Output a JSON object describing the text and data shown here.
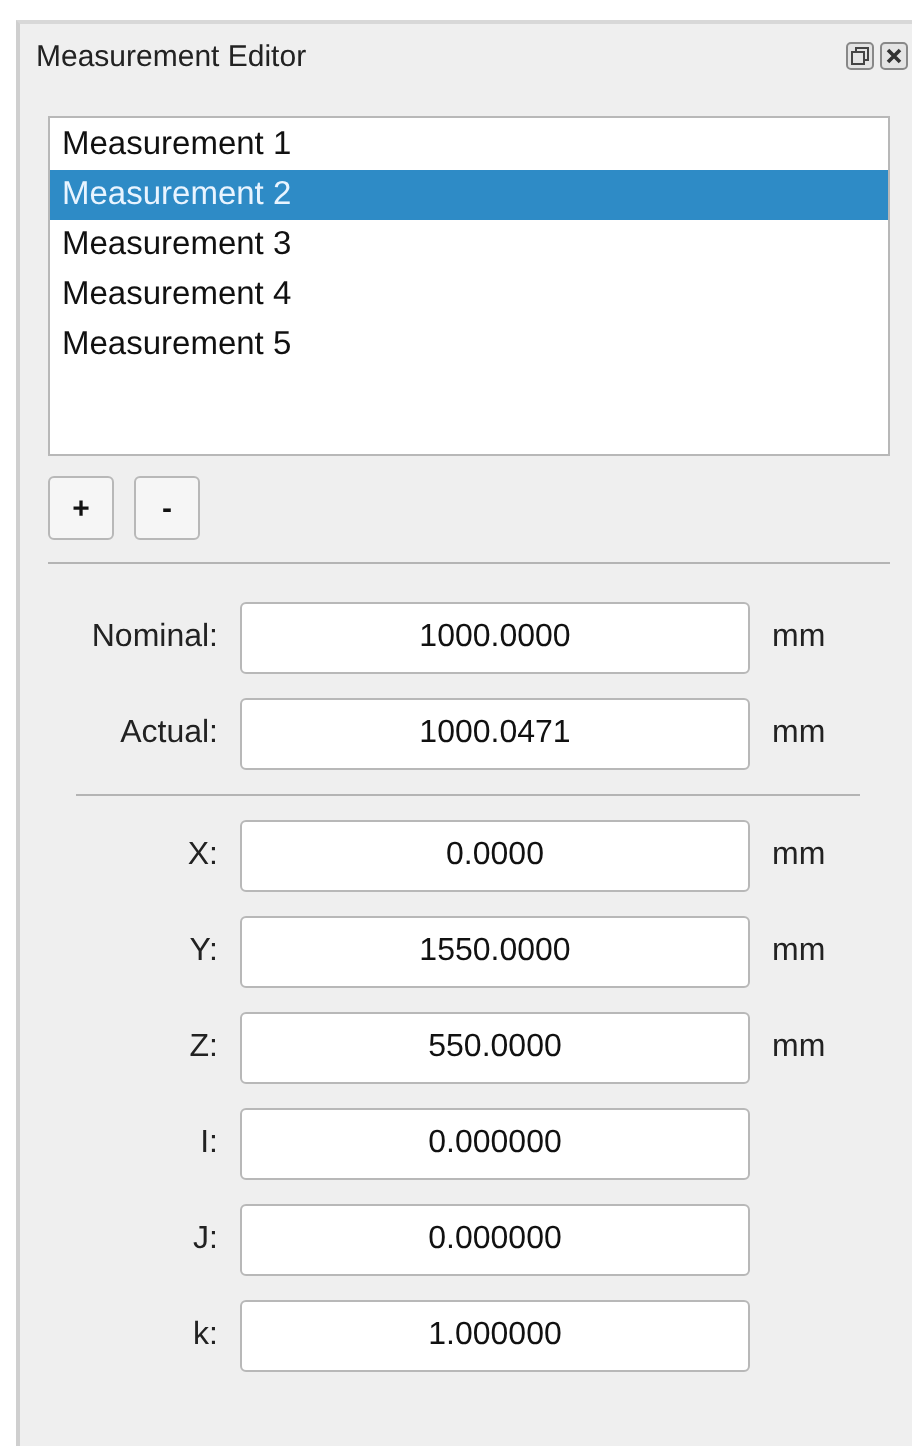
{
  "window": {
    "title": "Measurement Editor"
  },
  "measurements": [
    {
      "label": "Measurement 1",
      "selected": false
    },
    {
      "label": "Measurement 2",
      "selected": true
    },
    {
      "label": "Measurement 3",
      "selected": false
    },
    {
      "label": "Measurement 4",
      "selected": false
    },
    {
      "label": "Measurement 5",
      "selected": false
    }
  ],
  "list_buttons": [
    "+",
    "-"
  ],
  "value_fields": [
    {
      "label": "Nominal:",
      "value": "1000.0000",
      "unit": "mm"
    },
    {
      "label": "Actual:",
      "value": "1000.0471",
      "unit": "mm"
    }
  ],
  "coordinate_fields": [
    {
      "label": "X:",
      "value": "0.0000",
      "unit": "mm"
    },
    {
      "label": "Y:",
      "value": "1550.0000",
      "unit": "mm"
    },
    {
      "label": "Z:",
      "value": "550.0000",
      "unit": "mm"
    },
    {
      "label": "I:",
      "value": "0.000000"
    },
    {
      "label": "J:",
      "value": "0.000000"
    },
    {
      "label": "k:",
      "value": "1.000000"
    }
  ]
}
